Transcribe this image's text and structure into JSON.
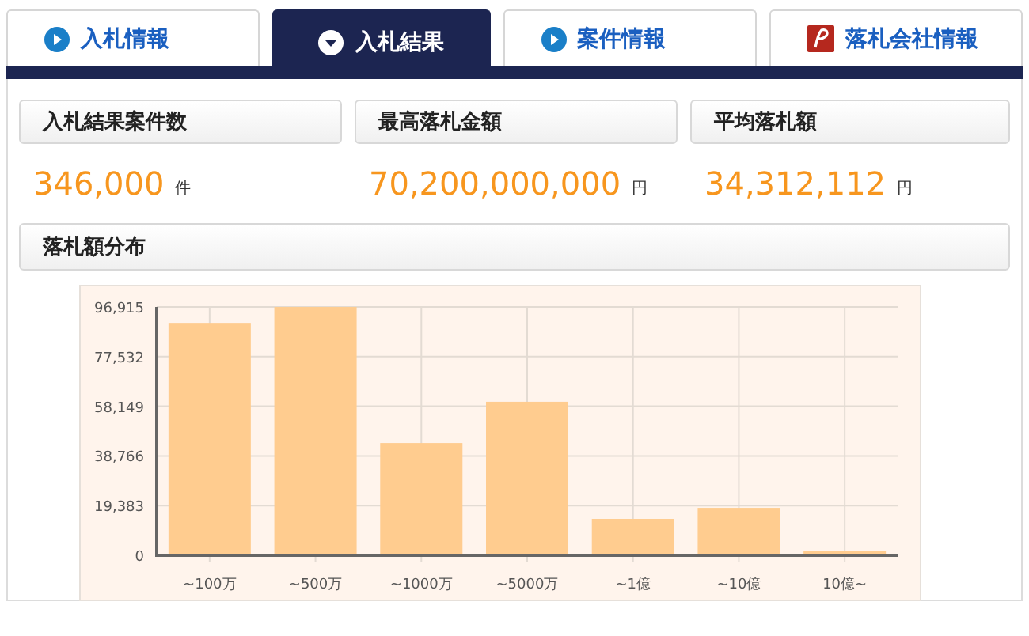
{
  "tabs": [
    {
      "label": "入札情報",
      "selected": false,
      "kind": "bullet"
    },
    {
      "label": "入札結果",
      "selected": true,
      "kind": "bullet"
    },
    {
      "label": "案件情報",
      "selected": false,
      "kind": "bullet"
    },
    {
      "label": "落札会社情報",
      "selected": false,
      "kind": "logo"
    }
  ],
  "stats": [
    {
      "label": "入札結果案件数",
      "value": "346,000",
      "unit": "件"
    },
    {
      "label": "最高落札金額",
      "value": "70,200,000,000",
      "unit": "円"
    },
    {
      "label": "平均落札額",
      "value": "34,312,112",
      "unit": "円"
    }
  ],
  "distribution": {
    "title": "落札額分布",
    "chart_data": {
      "type": "bar",
      "categories": [
        "~100万",
        "~500万",
        "~1000万",
        "~5000万",
        "~1億",
        "~10億",
        "10億~"
      ],
      "series": [
        {
          "color": "#ffcc8f",
          "values": [
            90700,
            96900,
            43800,
            59900,
            14200,
            18500,
            1500
          ]
        }
      ],
      "ylim": [
        0,
        96915
      ],
      "grid": true,
      "yticks": [
        {
          "value": 0,
          "label": "0"
        },
        {
          "value": 19383,
          "label": "19,383"
        },
        {
          "value": 38766,
          "label": "38,766"
        },
        {
          "value": 58149,
          "label": "58,149"
        },
        {
          "value": 77532,
          "label": "77,532"
        },
        {
          "value": 96915,
          "label": "96,915"
        }
      ]
    }
  }
}
